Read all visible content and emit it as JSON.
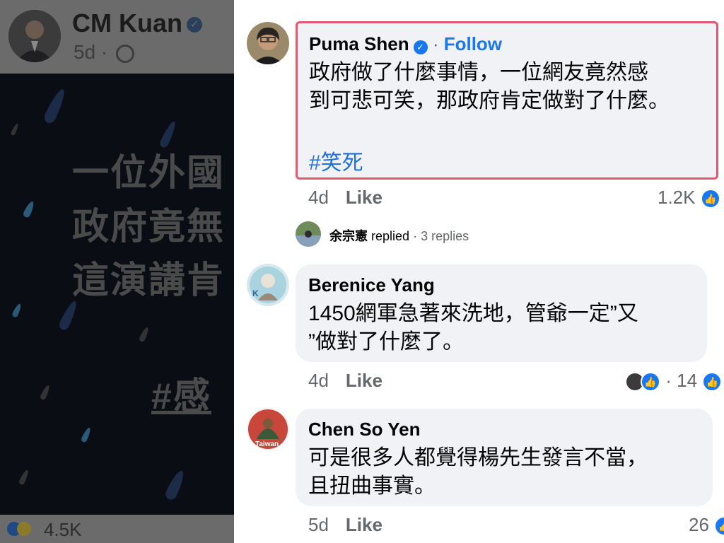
{
  "post": {
    "author": "CM Kuan",
    "time": "5d",
    "image_lines": [
      "一位外國",
      "政府竟無",
      "這演講肯"
    ],
    "image_hashtag": "#感",
    "reaction_count": "4.5K"
  },
  "comments": [
    {
      "author": "Puma Shen",
      "follow_label": "Follow",
      "lines": [
        "政府做了什麼事情，一位網友竟然感",
        "到可悲可笑，那政府肯定做對了什麼。"
      ],
      "hashtag": "#笑死",
      "time": "4d",
      "like_label": "Like",
      "reactions": "1.2K"
    },
    {
      "author": "Berenice Yang",
      "lines": [
        "1450網軍急著來洗地，管爺一定”又",
        "”做對了什麼了。"
      ],
      "time": "4d",
      "like_label": "Like",
      "reactions": "14"
    },
    {
      "author": "Chen So Yen",
      "lines": [
        "可是很多人都覺得楊先生發言不當，",
        "且扭曲事實。"
      ],
      "time": "5d",
      "like_label": "Like",
      "reactions": "26"
    }
  ],
  "reply_summary": {
    "name": "余宗憲",
    "action": "replied",
    "count": "3 replies"
  },
  "colors": {
    "highlight_border": "#e8566b",
    "link_blue": "#1877f2",
    "bubble_bg": "#f0f2f5"
  }
}
